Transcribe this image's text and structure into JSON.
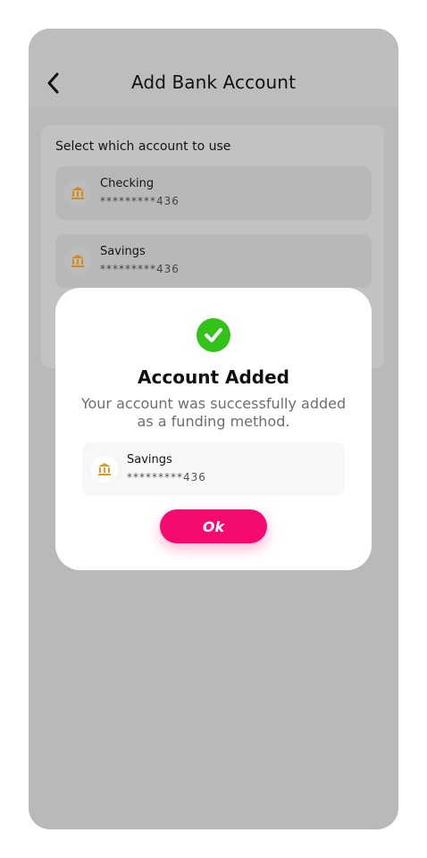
{
  "header": {
    "title": "Add Bank Account"
  },
  "card": {
    "title": "Select which account to use",
    "accounts": [
      {
        "name": "Checking",
        "number": "*********436"
      },
      {
        "name": "Savings",
        "number": "*********436"
      }
    ]
  },
  "modal": {
    "title": "Account Added",
    "message": "Your account was successfully added as a funding method.",
    "account": {
      "name": "Savings",
      "number": "*********436"
    },
    "ok_label": "Ok"
  },
  "colors": {
    "accent": "#f50a6f",
    "success": "#33c21a",
    "bank_icon": "#e39a1b"
  },
  "icons": {
    "back": "chevron-left-icon",
    "bank": "bank-icon",
    "success": "check-circle-icon"
  }
}
